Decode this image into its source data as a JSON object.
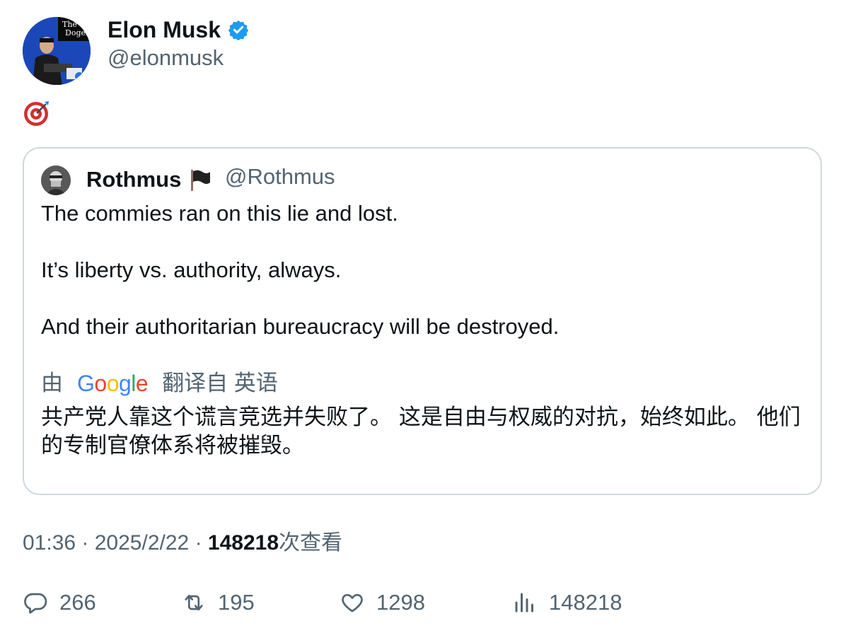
{
  "tweet": {
    "author_name": "Elon Musk",
    "author_handle": "@elonmusk",
    "emoji_text": "🎯",
    "timestamp_time": "01:36",
    "timestamp_date": "2025/2/22",
    "view_count": "148218",
    "view_label": "次查看"
  },
  "quote": {
    "name": "Rothmus",
    "flag": "🏴",
    "handle": "@Rothmus",
    "lines": [
      "The commies ran on this lie and lost.",
      "It’s liberty vs. authority, always.",
      "And their authoritarian bureaucracy will be destroyed."
    ],
    "translate_prefix": "由",
    "translate_brand": "Google",
    "translate_suffix": "翻译自 英语",
    "translated_text": "共产党人靠这个谎言竞选并失败了。 这是自由与权威的对抗，始终如此。 他们的专制官僚体系将被摧毁。"
  },
  "actions": {
    "reply_count": "266",
    "retweet_count": "195",
    "like_count": "1298",
    "views_count": "148218"
  },
  "colors": {
    "verified_blue": "#1d9bf0",
    "secondary_text": "#536471",
    "border": "#cfd9de"
  },
  "icons": [
    "verified-badge-icon",
    "direct-hit-emoji",
    "black-flag-emoji",
    "reply-icon",
    "retweet-icon",
    "like-icon",
    "views-icon"
  ]
}
